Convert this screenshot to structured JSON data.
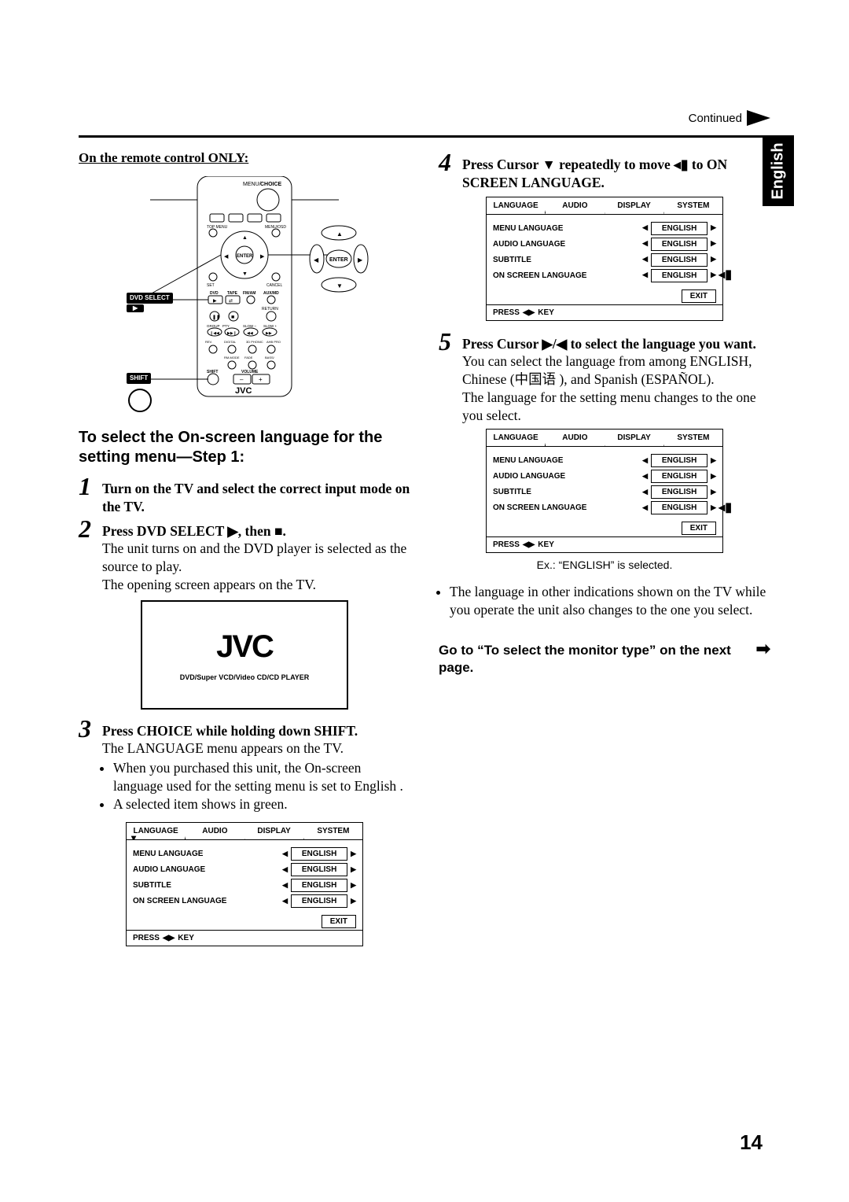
{
  "header": {
    "continued": "Continued",
    "side_tab": "English"
  },
  "left": {
    "remote_only": "On the remote control ONLY:",
    "remote_labels": {
      "menu_choice": "CHOICE",
      "menu": "MENU/",
      "top_menu": "TOP MENU",
      "menu_osd": "MENU/OSD",
      "enter": "ENTER",
      "set": "SET",
      "cancel": "CANCEL",
      "dvd_select": "DVD SELECT",
      "shift": "SHIFT",
      "jvc": "JVC",
      "volume": "VOLUME",
      "shift_small": "SHIFT",
      "dvd": "DVD",
      "tape": "TAPE",
      "fmam": "FM/AM",
      "auxmd": "AUX/MD",
      "return": "RETURN",
      "group": "GROUP",
      "pty_search": "PTY SEARCH",
      "slow_minus": "SLOW –",
      "slow_plus": "SLOW +",
      "rev_control": "REV. CONTROL",
      "digital_eq_pro": "DIGITAL EQ PRO",
      "rm_mode": "RM-MODE",
      "fade_muting": "FADE MUTING",
      "bass_trebl": "BASS/ TREBL",
      "_3d": "3D PHONIC",
      "ahb_pro": "AHB PRO"
    },
    "section_title": "To select the On-screen language for the setting menu—Step 1:",
    "step1": {
      "num": "1",
      "lead": "Turn on the TV and select the correct input mode on the TV."
    },
    "step2": {
      "num": "2",
      "lead_a": "Press DVD SELECT ",
      "lead_b": ", then ",
      "body1": "The unit turns on and the DVD player is selected as the source to play.",
      "body2": "The opening screen appears on the TV."
    },
    "splash": {
      "logo": "JVC",
      "sub": "DVD/Super VCD/Video CD/CD PLAYER"
    },
    "step3": {
      "num": "3",
      "lead": "Press CHOICE while holding down SHIFT.",
      "body1": "The LANGUAGE menu appears on the TV.",
      "bullet1": "When you purchased this unit, the On-screen language used for the setting menu is set to English .",
      "bullet2": "A selected item shows in green."
    }
  },
  "right": {
    "step4": {
      "num": "4",
      "lead_a": "Press Cursor ",
      "lead_b": " repeatedly to move ",
      "lead_c": " to ON SCREEN LANGUAGE."
    },
    "step5": {
      "num": "5",
      "lead_a": "Press Cursor ",
      "lead_b": " to select the language you want.",
      "body1": "You can select the language from among ENGLISH, Chinese (中国语 ), and Spanish (ESPAÑOL).",
      "body2": "The language for the setting menu changes to the one you select."
    },
    "osd_caption": "Ex.: “ENGLISH” is selected.",
    "note_bullet": "The language in other indications shown on the TV while you operate the unit also changes to the one you select.",
    "next": "Go to “To select the monitor type” on the next page."
  },
  "osd": {
    "tabs": [
      "LANGUAGE",
      "AUDIO",
      "DISPLAY",
      "SYSTEM"
    ],
    "rows": [
      {
        "label": "MENU LANGUAGE",
        "value": "ENGLISH"
      },
      {
        "label": "AUDIO LANGUAGE",
        "value": "ENGLISH"
      },
      {
        "label": "SUBTITLE",
        "value": "ENGLISH"
      },
      {
        "label": "ON SCREEN LANGUAGE",
        "value": "ENGLISH"
      }
    ],
    "exit": "EXIT",
    "foot_a": "PRESS",
    "foot_b": "KEY"
  },
  "page_number": "14"
}
